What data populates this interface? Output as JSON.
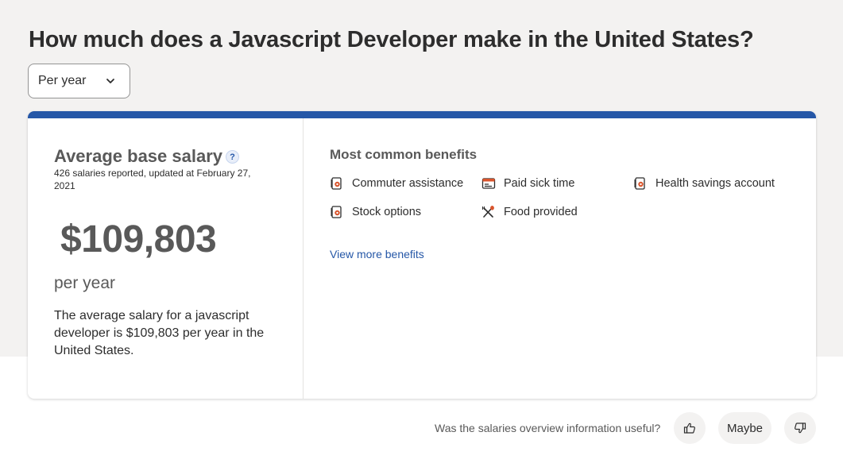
{
  "page": {
    "title": "How much does a Javascript Developer make in the United States?"
  },
  "period_select": {
    "value": "Per year",
    "icon": "chevron-down-icon"
  },
  "salary": {
    "heading": "Average base salary",
    "help_glyph": "?",
    "reported_text": "426 salaries reported, updated at February 27, 2021",
    "value": "$109,803",
    "period": "per year",
    "description": "The average salary for a javascript developer is $109,803 per year in the United States."
  },
  "benefits": {
    "heading": "Most common benefits",
    "items": [
      {
        "label": "Commuter assistance",
        "icon": "commuter-assistance-icon"
      },
      {
        "label": "Paid sick time",
        "icon": "paid-sick-time-icon"
      },
      {
        "label": "Health savings account",
        "icon": "health-savings-account-icon"
      },
      {
        "label": "Stock options",
        "icon": "stock-options-icon"
      },
      {
        "label": "Food provided",
        "icon": "food-provided-icon"
      }
    ],
    "view_more": "View more benefits"
  },
  "feedback": {
    "question": "Was the salaries overview information useful?",
    "maybe_label": "Maybe",
    "thumbs_up_icon": "thumbs-up-icon",
    "thumbs_down_icon": "thumbs-down-icon"
  },
  "colors": {
    "accent": "#2557a7",
    "benefit_icon_accent": "#d9542c",
    "background_band": "#f3f2f1"
  }
}
